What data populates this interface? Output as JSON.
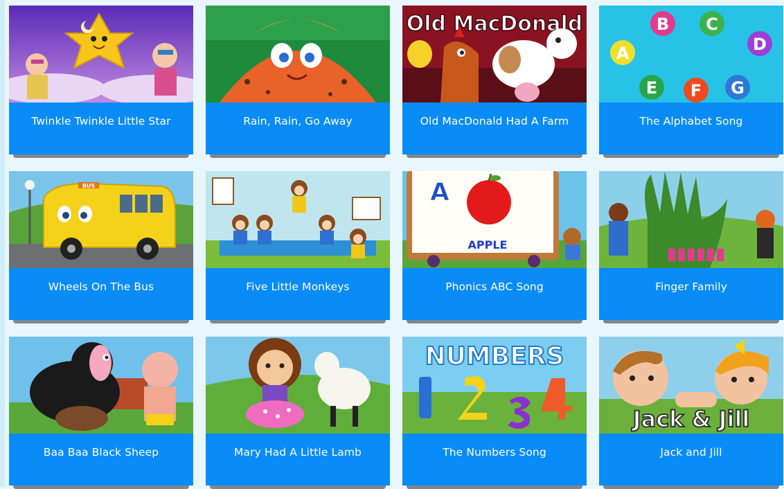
{
  "videos": [
    {
      "title": "Twinkle Twinkle Little Star",
      "thumb_text": ""
    },
    {
      "title": "Rain, Rain, Go Away",
      "thumb_text": ""
    },
    {
      "title": "Old MacDonald Had A Farm",
      "thumb_text": "Old MacDonald"
    },
    {
      "title": "The Alphabet Song",
      "thumb_text": "ABCDEFG"
    },
    {
      "title": "Wheels On The Bus",
      "thumb_text": "BUS"
    },
    {
      "title": "Five Little Monkeys",
      "thumb_text": ""
    },
    {
      "title": "Phonics ABC Song",
      "thumb_text": "APPLE",
      "letter": "A"
    },
    {
      "title": "Finger Family",
      "thumb_text": ""
    },
    {
      "title": "Baa Baa Black Sheep",
      "thumb_text": ""
    },
    {
      "title": "Mary Had A Little Lamb",
      "thumb_text": ""
    },
    {
      "title": "The Numbers Song",
      "thumb_text": "NUMBERS"
    },
    {
      "title": "Jack and Jill",
      "thumb_text": "Jack & Jill"
    }
  ],
  "colors": {
    "caption_bg": "#0a8cf8",
    "caption_text": "#ffffff",
    "page_bg": "#e9f6fb"
  }
}
